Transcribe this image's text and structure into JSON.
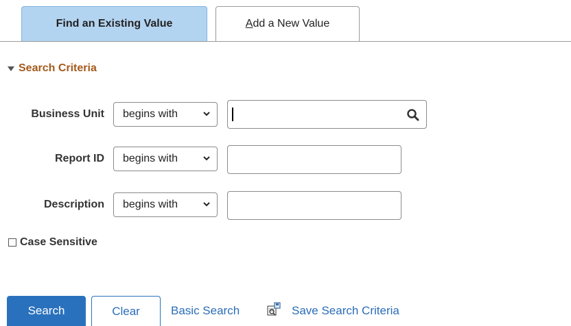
{
  "tabs": [
    {
      "label": "Find an Existing Value",
      "active": true
    },
    {
      "label_first": "A",
      "label_rest": "dd a New Value",
      "active": false
    }
  ],
  "search_criteria": {
    "title": "Search Criteria",
    "fields": [
      {
        "label": "Business Unit",
        "operator": "begins with",
        "value": "",
        "has_lookup": true,
        "focused": true
      },
      {
        "label": "Report ID",
        "operator": "begins with",
        "value": ""
      },
      {
        "label": "Description",
        "operator": "begins with",
        "value": ""
      }
    ],
    "case_sensitive": {
      "label": "Case Sensitive",
      "checked": false
    }
  },
  "actions": {
    "search": "Search",
    "clear": "Clear",
    "basic_search": "Basic Search",
    "save_search": "Save Search Criteria"
  },
  "colors": {
    "active_tab": "#b3d4f1",
    "section_title": "#a45a1c",
    "primary_button": "#2a71bd",
    "link": "#2a6db8"
  },
  "icons": [
    "chevron-down-icon",
    "search-icon",
    "save-search-icon",
    "collapse-triangle-icon"
  ]
}
